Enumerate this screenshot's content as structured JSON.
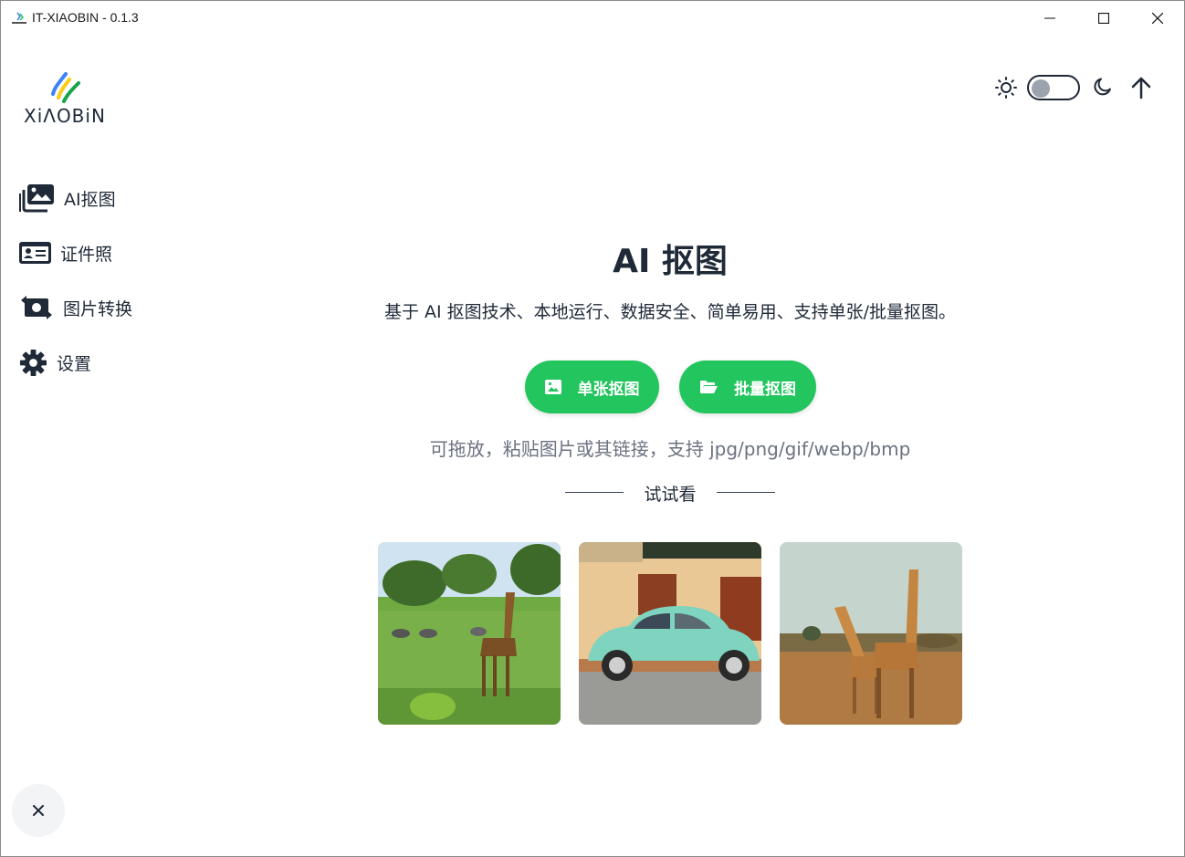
{
  "window": {
    "title": "IT-XIAOBIN - 0.1.3"
  },
  "logo": {
    "text": "XiΛOBiN"
  },
  "header": {
    "theme_toggle": "off",
    "icons": [
      "sun-icon",
      "moon-icon",
      "arrow-up-icon"
    ]
  },
  "sidebar": {
    "items": [
      {
        "label": "AI抠图",
        "icon": "images-icon"
      },
      {
        "label": "证件照",
        "icon": "id-card-icon"
      },
      {
        "label": "图片转换",
        "icon": "money-bill-transfer-icon"
      },
      {
        "label": "设置",
        "icon": "gear-icon"
      }
    ]
  },
  "main": {
    "title": "AI 抠图",
    "description": "基于 AI 抠图技术、本地运行、数据安全、简单易用、支持单张/批量抠图。",
    "buttons": {
      "single": "单张抠图",
      "batch": "批量抠图"
    },
    "hint": "可拖放，粘贴图片或其链接，支持 jpg/png/gif/webp/bmp",
    "try_label": "试试看",
    "samples": [
      "giraffe-savanna",
      "vintage-car",
      "two-giraffes"
    ]
  },
  "colors": {
    "accent": "#22c55e",
    "text": "#1f2937",
    "muted": "#6b7280"
  }
}
